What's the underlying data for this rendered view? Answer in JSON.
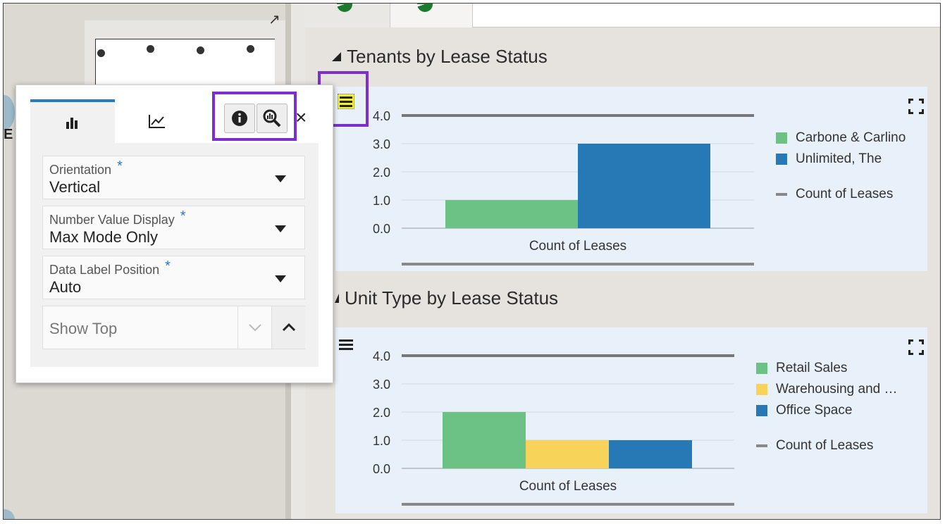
{
  "popup": {
    "fields": [
      {
        "label": "Orientation",
        "required": "*",
        "value": "Vertical"
      },
      {
        "label": "Number Value Display",
        "required": "*",
        "value": "Max Mode Only"
      },
      {
        "label": "Data Label Position",
        "required": "*",
        "value": "Auto"
      }
    ],
    "show_top": {
      "placeholder": "Show Top"
    },
    "close_label": "×"
  },
  "left_panel": {
    "cut_label": "E"
  },
  "sections": [
    {
      "title": "Tenants by Lease Status"
    },
    {
      "title": "Unit Type by Lease Status"
    }
  ],
  "colors": {
    "green": "#6cc284",
    "blue": "#2779b5",
    "yellow": "#f7d359",
    "accent_purple": "#7b2fcf",
    "highlight_yellow": "#f4f12b"
  },
  "chart_data": [
    {
      "type": "bar",
      "title": "Tenants by Lease Status",
      "categories": [
        "Count of Leases"
      ],
      "series": [
        {
          "name": "Carbone & Carlino",
          "color": "#6cc284",
          "values": [
            1
          ]
        },
        {
          "name": "Unlimited, The",
          "color": "#2779b5",
          "values": [
            3
          ]
        }
      ],
      "reference_line": {
        "name": "Count of Leases",
        "color": "#888888"
      },
      "y_ticks": [
        "4.0",
        "3.0",
        "2.0",
        "1.0",
        "0.0"
      ],
      "ylim": [
        0,
        4
      ],
      "legend_position": "right"
    },
    {
      "type": "bar",
      "title": "Unit Type by Lease Status",
      "categories": [
        "Count of Leases"
      ],
      "series": [
        {
          "name": "Retail Sales",
          "color": "#6cc284",
          "values": [
            2
          ]
        },
        {
          "name": "Warehousing and …",
          "color": "#f7d359",
          "values": [
            1
          ]
        },
        {
          "name": "Office Space",
          "color": "#2779b5",
          "values": [
            1
          ]
        }
      ],
      "reference_line": {
        "name": "Count of Leases",
        "color": "#888888"
      },
      "y_ticks": [
        "4.0",
        "3.0",
        "2.0",
        "1.0",
        "0.0"
      ],
      "ylim": [
        0,
        4
      ],
      "legend_position": "right"
    }
  ]
}
